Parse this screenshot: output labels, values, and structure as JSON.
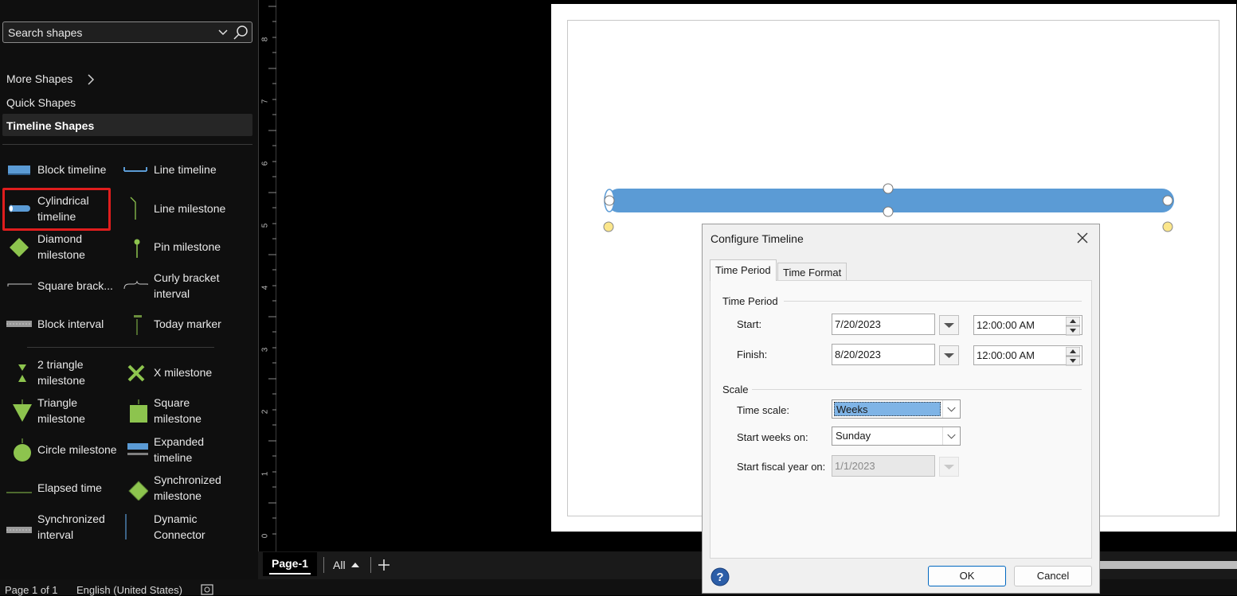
{
  "sidebar": {
    "search_placeholder": "Search shapes",
    "nav": {
      "more_shapes": "More Shapes",
      "quick_shapes": "Quick Shapes",
      "timeline_shapes": "Timeline Shapes"
    },
    "shapes": [
      {
        "label": "Block timeline",
        "icon": "block-timeline-icon"
      },
      {
        "label": "Line timeline",
        "icon": "line-timeline-icon"
      },
      {
        "label": "Cylindrical timeline",
        "icon": "cylindrical-timeline-icon"
      },
      {
        "label": "Line milestone",
        "icon": "line-milestone-icon"
      },
      {
        "label": "Diamond milestone",
        "icon": "diamond-milestone-icon"
      },
      {
        "label": "Pin milestone",
        "icon": "pin-milestone-icon"
      },
      {
        "label": "Square brack...",
        "icon": "square-bracket-icon"
      },
      {
        "label": "Curly bracket interval",
        "icon": "curly-bracket-icon"
      },
      {
        "label": "Block interval",
        "icon": "block-interval-icon"
      },
      {
        "label": "Today marker",
        "icon": "today-marker-icon"
      },
      {
        "label": "2 triangle milestone",
        "icon": "two-triangle-milestone-icon"
      },
      {
        "label": "X milestone",
        "icon": "x-milestone-icon"
      },
      {
        "label": "Triangle milestone",
        "icon": "triangle-milestone-icon"
      },
      {
        "label": "Square milestone",
        "icon": "square-milestone-icon"
      },
      {
        "label": "Circle milestone",
        "icon": "circle-milestone-icon"
      },
      {
        "label": "Expanded timeline",
        "icon": "expanded-timeline-icon"
      },
      {
        "label": "Elapsed time",
        "icon": "elapsed-time-icon"
      },
      {
        "label": "Synchronized milestone",
        "icon": "synchronized-milestone-icon"
      },
      {
        "label": "Synchronized interval",
        "icon": "synchronized-interval-icon"
      },
      {
        "label": "Dynamic Connector",
        "icon": "dynamic-connector-icon"
      }
    ]
  },
  "ruler": {
    "labels": [
      "8",
      "7",
      "6",
      "5",
      "4",
      "3",
      "2",
      "1",
      "0"
    ]
  },
  "page_tabs": {
    "active": "Page-1",
    "all": "All"
  },
  "status": {
    "page": "Page 1 of 1",
    "language": "English (United States)"
  },
  "dialog": {
    "title": "Configure Timeline",
    "tabs": [
      "Time Period",
      "Time Format"
    ],
    "time_period_group": "Time Period",
    "start_label": "Start:",
    "start_date": "7/20/2023",
    "start_time": "12:00:00 AM",
    "finish_label": "Finish:",
    "finish_date": "8/20/2023",
    "finish_time": "12:00:00 AM",
    "scale_group": "Scale",
    "time_scale_label": "Time scale:",
    "time_scale_value": "Weeks",
    "start_weeks_label": "Start weeks on:",
    "start_weeks_value": "Sunday",
    "fiscal_label": "Start fiscal year on:",
    "fiscal_value": "1/1/2023",
    "ok": "OK",
    "cancel": "Cancel"
  },
  "colors": {
    "timeline_bar": "#5b9bd5",
    "milestone_green": "#8dc44e",
    "highlight": "#e01d1d",
    "handle_yellow": "#fbe68b"
  }
}
